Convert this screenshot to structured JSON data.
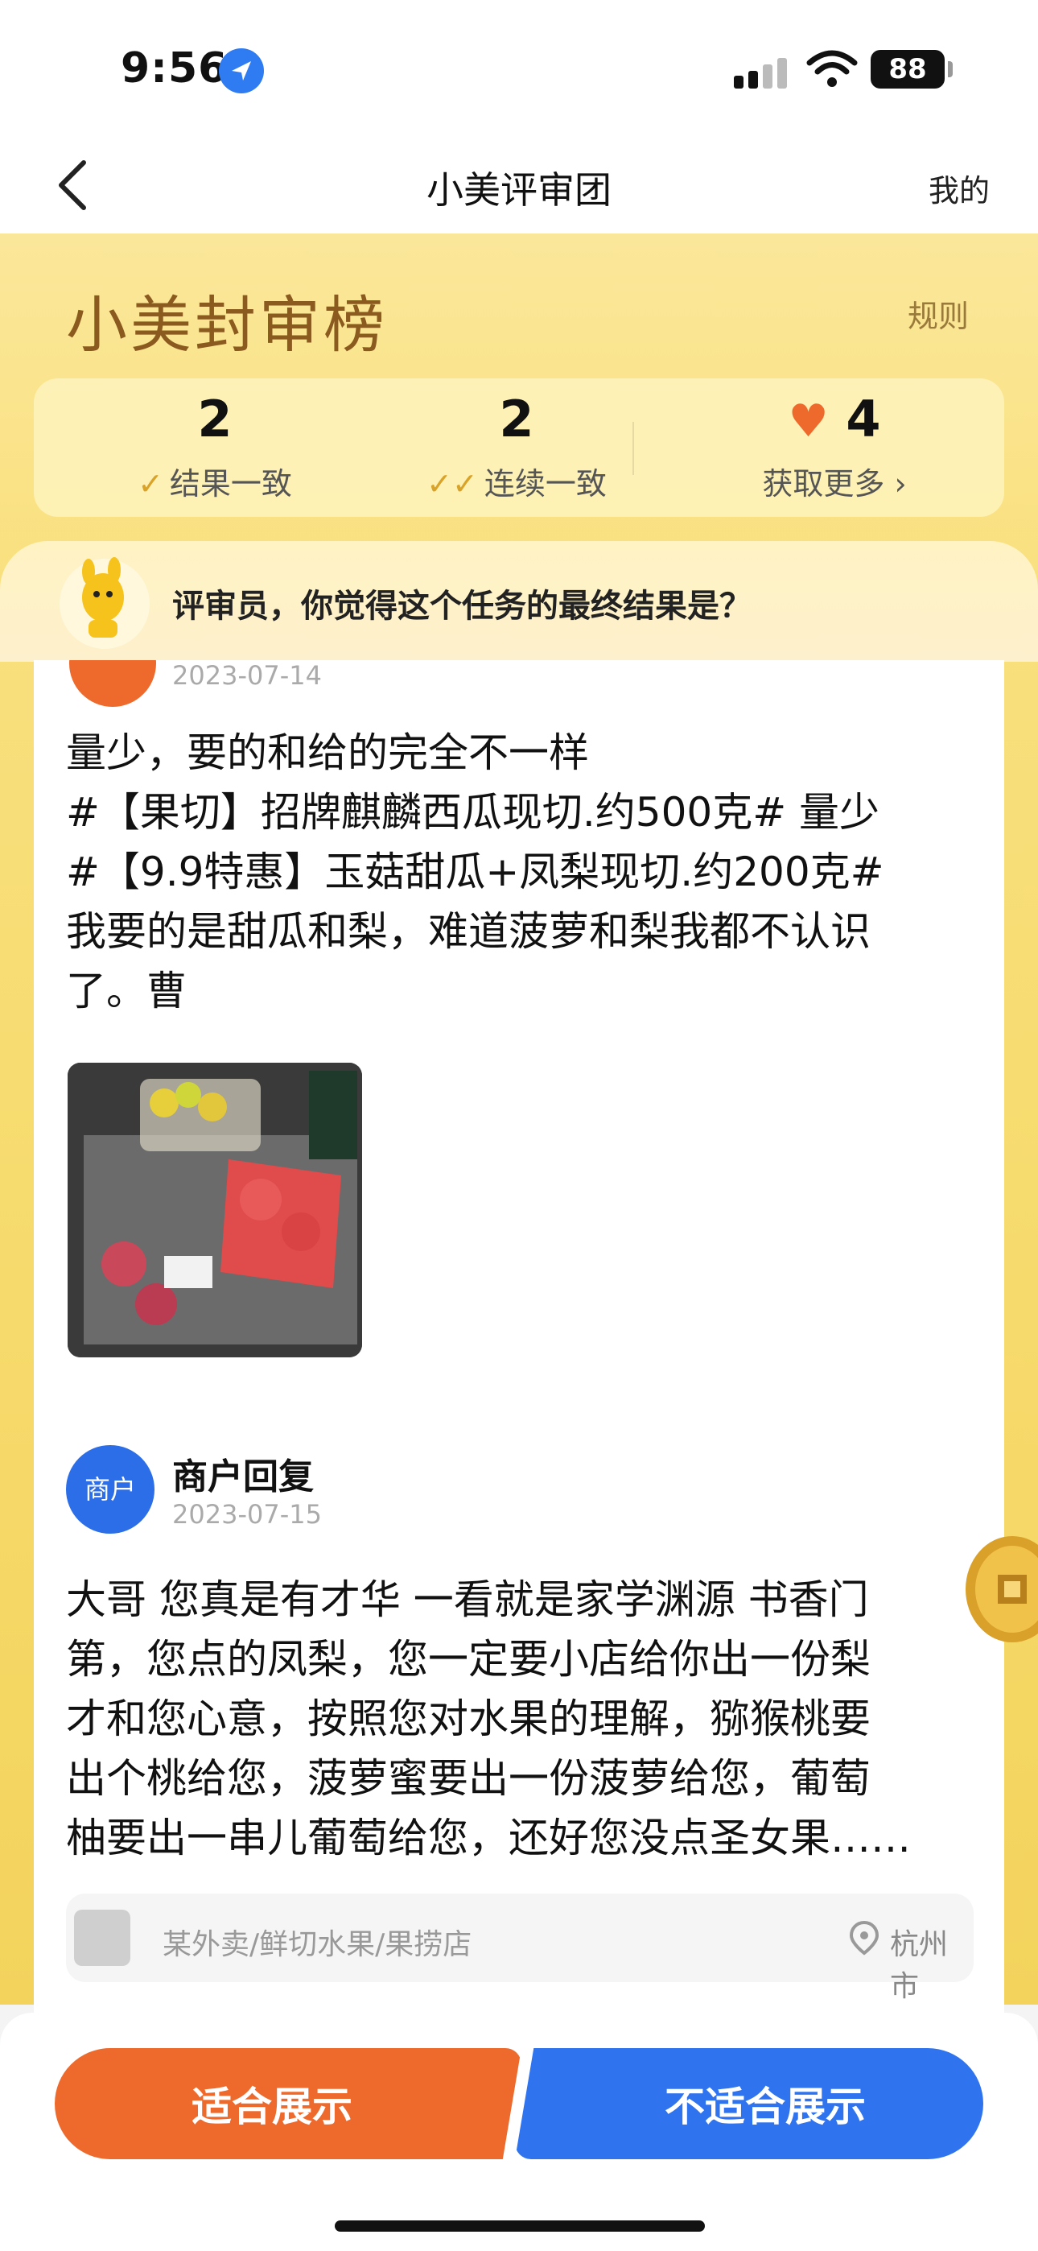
{
  "status_bar": {
    "time": "9:56",
    "battery": "88"
  },
  "nav": {
    "title": "小美评审团",
    "mine_label": "我的"
  },
  "header": {
    "brand_title": "小美封审榜",
    "rules_label": "规则"
  },
  "stats": [
    {
      "value": "2",
      "label": "结果一致"
    },
    {
      "value": "2",
      "label": "连续一致"
    },
    {
      "value": "4",
      "label": "获取更多 ›"
    }
  ],
  "question": {
    "text": "评审员，你觉得这个任务的最终结果是？"
  },
  "review": {
    "date": "2023-07-14",
    "lines": [
      "量少，要的和给的完全不一样",
      "#【果切】招牌麒麟西瓜现切.约500克# 量少",
      "#【9.9特惠】玉菇甜瓜+凤梨现切.约200克#",
      "我要的是甜瓜和梨，难道菠萝和梨我都不认识",
      "了。曹"
    ]
  },
  "merchant_reply": {
    "avatar_text": "商户",
    "name": "商户回复",
    "date": "2023-07-15",
    "lines": [
      "大哥 您真是有才华 一看就是家学渊源 书香门",
      "第，您点的凤梨，您一定要小店给你出一份梨",
      "才和您心意，按照您对水果的理解，猕猴桃要",
      "出个桃给您，菠萝蜜要出一份菠萝给您，葡萄",
      "柚要出一串儿葡萄给您，还好您没点圣女果……"
    ]
  },
  "store": {
    "category": "某外卖/鲜切水果/果捞店",
    "city": "杭州市"
  },
  "actions": {
    "suitable_label": "适合展示",
    "unsuitable_label": "不适合展示"
  },
  "colors": {
    "accent_orange": "#ee6a2c",
    "accent_blue": "#2f73ee",
    "header_yellow": "#f9e07e",
    "brand_brown": "#8a5a1e"
  },
  "icons": [
    "location-arrow-icon",
    "signal-icon",
    "wifi-icon",
    "battery-icon",
    "back-chevron-icon",
    "check-icon",
    "double-check-icon",
    "heart-icon",
    "mascot-icon",
    "store-thumbnail-icon",
    "location-pin-icon",
    "coin-icon"
  ]
}
